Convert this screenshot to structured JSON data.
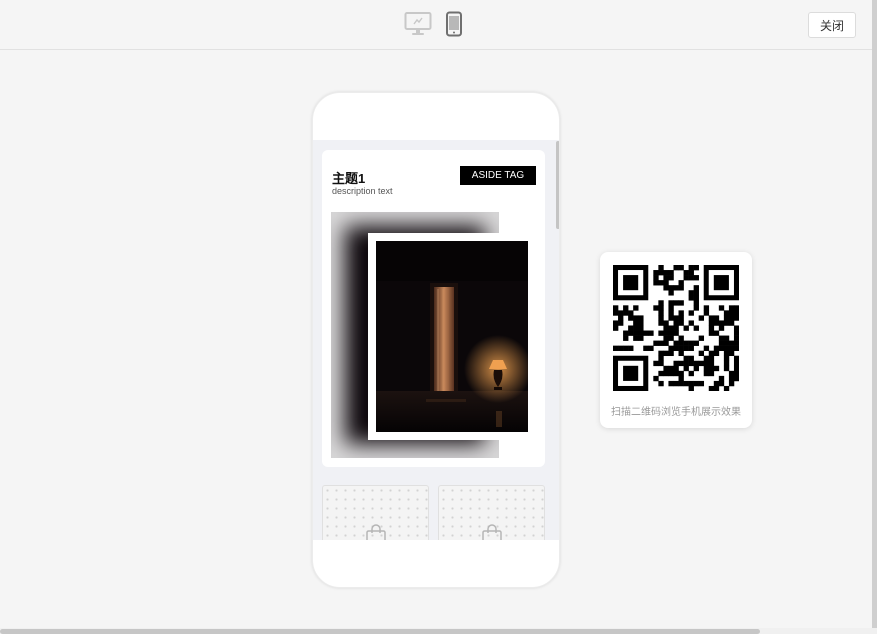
{
  "toolbar": {
    "desktop_icon": "monitor-icon",
    "mobile_icon": "smartphone-icon",
    "close_label": "关闭"
  },
  "preview": {
    "card": {
      "title": "主题1",
      "description": "description text",
      "aside_tag": "ASIDE TAG"
    },
    "tiles": [
      {
        "icon": "shopping-bag-icon"
      },
      {
        "icon": "shopping-bag-icon"
      }
    ]
  },
  "qr": {
    "caption": "扫描二维码浏览手机展示效果"
  },
  "colors": {
    "accent": "#000000",
    "background": "#f5f5f5",
    "screen_bg": "#f0f1f5"
  }
}
